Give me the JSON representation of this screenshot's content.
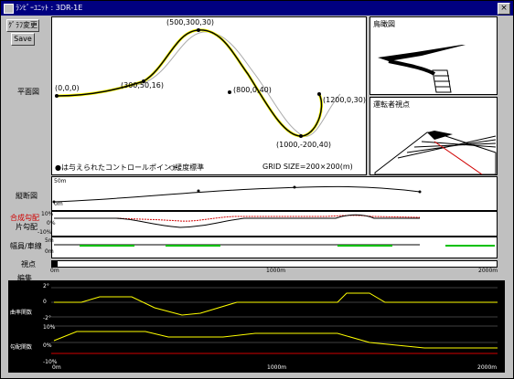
{
  "window": {
    "title": "ﾗﾝﾋﾞｰﾕﾆｯﾄ : 3DR-1E",
    "close_glyph": "×"
  },
  "buttons": {
    "changes": "ｸﾞﾗﾌ変更",
    "save": "Save"
  },
  "plan": {
    "label": "平面図",
    "points": [
      {
        "text": "(0,0,0)"
      },
      {
        "text": "(500,300,30)"
      },
      {
        "text": "(300,50,16)"
      },
      {
        "text": "(800,0,40)"
      },
      {
        "text": "(1200,0,30)"
      },
      {
        "text": "(1000,-200,40)"
      }
    ],
    "legend": "●は与えられたコントロールポイント",
    "legend2": "◇緩度標準",
    "grid_size": "GRID SIZE=200×200(m)"
  },
  "bird_view": {
    "label": "鳥瞰図"
  },
  "driver_view": {
    "label": "運転者視点"
  },
  "profile": {
    "label": "縦断図",
    "ticks": [
      "50m",
      "0m"
    ]
  },
  "grade": {
    "label_red": "合成勾配",
    "label": "片勾配",
    "ticks": [
      "10%",
      "0%",
      "-10%"
    ]
  },
  "width": {
    "label": "幅員/車線",
    "ticks": [
      "5m",
      "0m"
    ]
  },
  "viewpoint": {
    "label": "視点"
  },
  "axis": {
    "start": "0m",
    "mid": "1000m",
    "end": "2000m"
  },
  "edit": {
    "label": "編集",
    "curvature": {
      "label": "曲率関数",
      "ticks": [
        "2°",
        "0",
        "-2°"
      ]
    },
    "gradient": {
      "label": "勾配関数",
      "ticks": [
        "10%",
        "0%",
        "-10%"
      ]
    }
  },
  "colors": {
    "title_bar": "#000080",
    "road_curve": "#000000",
    "control_curve": "#ffff00",
    "grade_red": "#d00000",
    "lane_green": "#00c000",
    "edit_bg": "#000000"
  }
}
